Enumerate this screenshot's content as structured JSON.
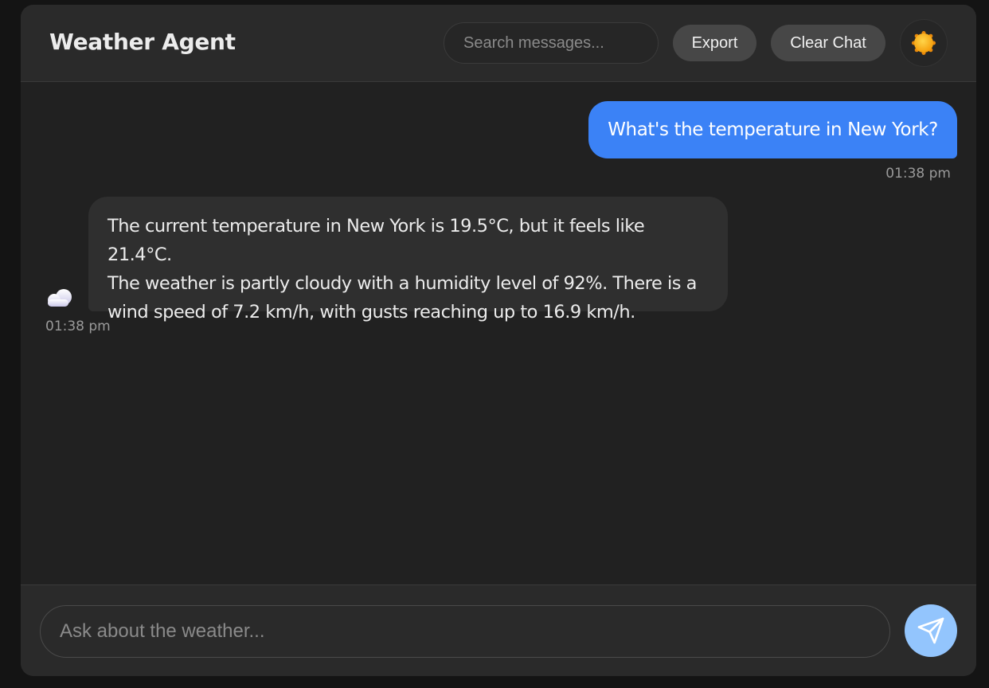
{
  "header": {
    "title": "Weather Agent",
    "search_placeholder": "Search messages...",
    "export_label": "Export",
    "clear_label": "Clear Chat",
    "theme_icon": "sun-icon"
  },
  "messages": [
    {
      "role": "user",
      "text": "What's the temperature in New York?",
      "time": "01:38 pm"
    },
    {
      "role": "assistant",
      "avatar_icon": "cloud-icon",
      "lines": [
        "The current temperature in New York is 19.5°C, but it feels like 21.4°C.",
        "The weather is partly cloudy with a humidity level of 92%. There is a",
        "wind speed of 7.2 km/h, with gusts reaching up to 16.9 km/h."
      ],
      "time": "01:38 pm"
    }
  ],
  "composer": {
    "placeholder": "Ask about the weather...",
    "send_icon": "send-icon"
  },
  "colors": {
    "accent": "#3b82f6",
    "send_button": "#93c5fd",
    "background": "#212121"
  }
}
